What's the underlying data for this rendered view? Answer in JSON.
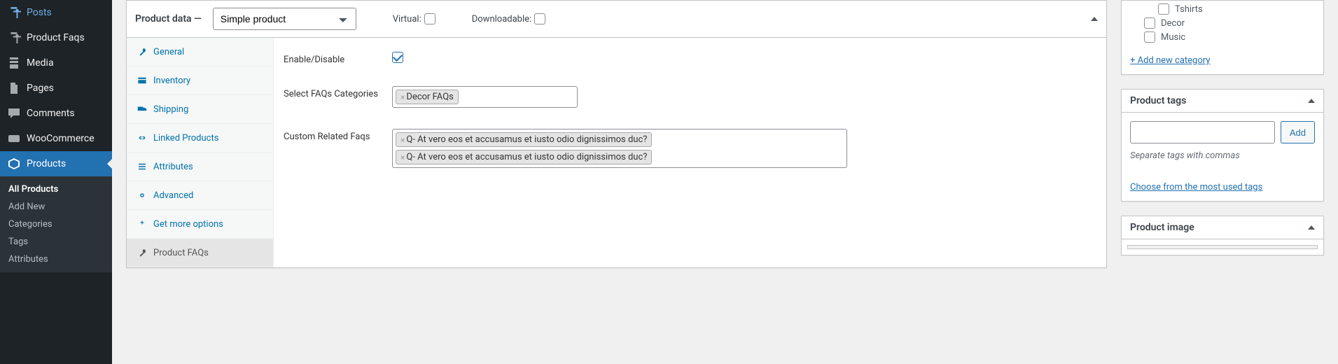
{
  "sidebar": {
    "items": [
      {
        "label": "Posts"
      },
      {
        "label": "Product Faqs"
      },
      {
        "label": "Media"
      },
      {
        "label": "Pages"
      },
      {
        "label": "Comments"
      },
      {
        "label": "WooCommerce"
      },
      {
        "label": "Products"
      }
    ],
    "submenu": [
      {
        "label": "All Products"
      },
      {
        "label": "Add New"
      },
      {
        "label": "Categories"
      },
      {
        "label": "Tags"
      },
      {
        "label": "Attributes"
      }
    ]
  },
  "product_data": {
    "header": {
      "label": "Product data —",
      "select_value": "Simple product",
      "virtual_label": "Virtual:",
      "downloadable_label": "Downloadable:"
    },
    "tabs": [
      {
        "label": "General"
      },
      {
        "label": "Inventory"
      },
      {
        "label": "Shipping"
      },
      {
        "label": "Linked Products"
      },
      {
        "label": "Attributes"
      },
      {
        "label": "Advanced"
      },
      {
        "label": "Get more options"
      },
      {
        "label": "Product FAQs"
      }
    ],
    "fields": {
      "enable_label": "Enable/Disable",
      "enable_checked": true,
      "select_faqs_label": "Select FAQs Categories",
      "faqs_chip": "Decor FAQs",
      "custom_label": "Custom Related Faqs",
      "custom_chip_1": "Q- At vero eos et accusamus et iusto odio dignissimos duc?",
      "custom_chip_2": "Q- At vero eos et accusamus et iusto odio dignissimos duc?"
    }
  },
  "categories": {
    "items": [
      {
        "label": "Tshirts"
      },
      {
        "label": "Decor"
      },
      {
        "label": "Music"
      }
    ],
    "add_link": "+ Add new category"
  },
  "tags_box": {
    "title": "Product tags",
    "add_button": "Add",
    "help": "Separate tags with commas",
    "choose": "Choose from the most used tags"
  },
  "image_box": {
    "title": "Product image"
  }
}
